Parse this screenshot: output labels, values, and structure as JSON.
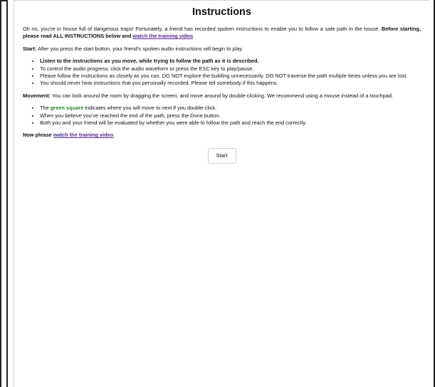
{
  "title": "Instructions",
  "intro": {
    "text": "Oh no, you’re in house full of dangerous traps! Fortunately, a friend has recorded spoken instructions to enable you to follow a safe path in the house. ",
    "bold": "Before starting, please read ALL INSTRUCTIONS below and ",
    "link": "watch the training video",
    "end": "."
  },
  "start_section": {
    "label": "Start:",
    "text": " After you press the start button, your friend’s spoken audio instructions will begin to play.",
    "bullets": [
      "Listen to the instructions as you move, while trying to follow the path as it is described.",
      "To control the audio progress, click the audio waveform or press the ESC key to play/pause.",
      "Please follow the instructions as closely as you can. DO NOT explore the building unnecessarily. DO NOT traverse the path multiple times unless you are lost.",
      "You should never hear instructions that you personally recorded. Please tell somebody if this happens."
    ]
  },
  "movement_section": {
    "label": "Movement:",
    "text": " You can look around the room by dragging the screen, and move around by double-clicking. We recommend using a mouse instead of a touchpad.",
    "bullet1_pre": "The ",
    "bullet1_green": "green square",
    "bullet1_post": " indicates where you will move to next if you double-click.",
    "bullets_rest": [
      "When you believe you’ve reached the end of the path, press the Done button.",
      "Both you and your friend will be evaluated by whether you were able to follow the path and reach the end correctly."
    ]
  },
  "outro": {
    "bold": "Now please ",
    "link": "watch the training video",
    "end": "."
  },
  "start_button_label": "Start",
  "colors": {
    "link": "#5a2b91",
    "highlight_green": "#1f8a1f"
  }
}
